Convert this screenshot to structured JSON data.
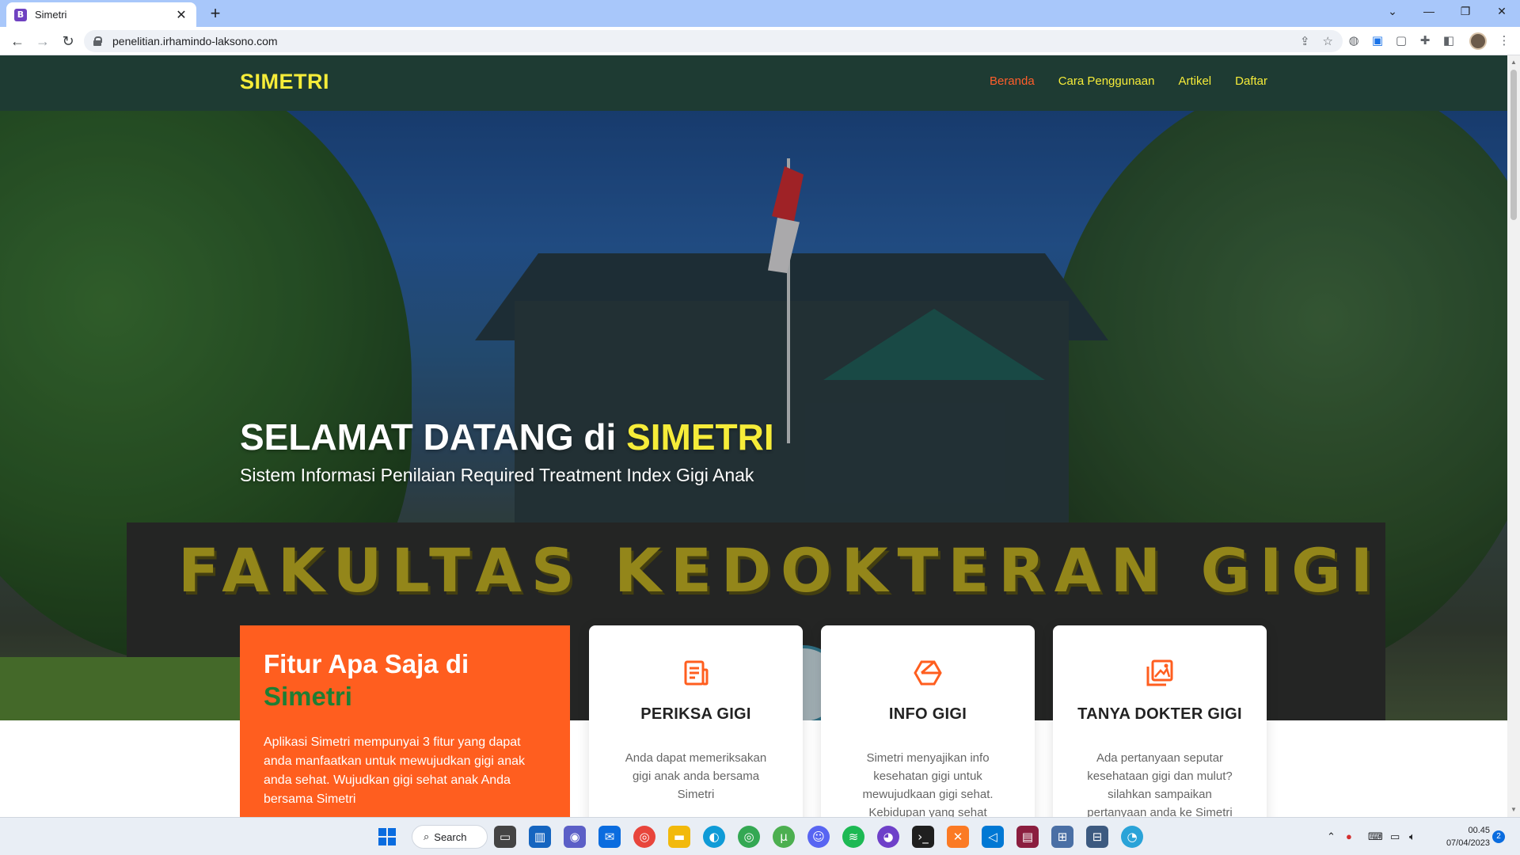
{
  "browser": {
    "tab_title": "Simetri",
    "favicon_letter": "B",
    "url": "penelitian.irhamindo-laksono.com"
  },
  "site": {
    "logo": "SIMETRI",
    "menu": [
      {
        "label": "Beranda",
        "active": true
      },
      {
        "label": "Cara Penggunaan",
        "active": false
      },
      {
        "label": "Artikel",
        "active": false
      },
      {
        "label": "Daftar",
        "active": false
      }
    ]
  },
  "hero": {
    "title_prefix": "SELAMAT DATANG di ",
    "title_highlight": "SIMETRI",
    "subtitle": "Sistem Informasi Penilaian Required Treatment Index Gigi Anak",
    "photo_sign": "FAKULTAS KEDOKTERAN GIGI"
  },
  "features": {
    "heading_line1": "Fitur Apa Saja di",
    "heading_line2": "Simetri",
    "description": "Aplikasi Simetri mempunyai 3 fitur yang dapat anda manfaatkan untuk mewujudkan gigi anak anda sehat. Wujudkan gigi sehat anak Anda bersama Simetri",
    "cards": [
      {
        "icon": "document-icon",
        "title": "PERIKSA GIGI",
        "text": "Anda dapat memeriksakan gigi anak anda bersama Simetri"
      },
      {
        "icon": "hexagon-icon",
        "title": "INFO GIGI",
        "text": "Simetri menyajikan info kesehatan gigi untuk mewujudkaan gigi sehat. Kebidupan yang sehat"
      },
      {
        "icon": "image-gallery-icon",
        "title": "TANYA DOKTER GIGI",
        "text": "Ada pertanyaan seputar kesehataan gigi dan mulut? silahkan sampaikan pertanyaan anda ke Simetri"
      }
    ]
  },
  "taskbar": {
    "search_label": "Search",
    "time": "00.45",
    "date": "07/04/2023",
    "notification_count": "2"
  },
  "colors": {
    "header_bg": "#1e3b33",
    "logo_yellow": "#f6ec39",
    "accent_orange": "#ff5e1f",
    "active_menu": "#ff5e2b",
    "feature_green": "#1e7e34"
  }
}
